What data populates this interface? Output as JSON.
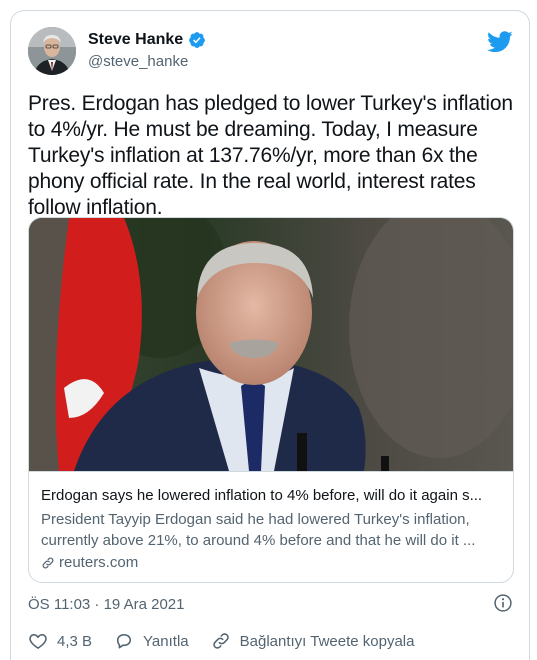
{
  "author": {
    "display_name": "Steve Hanke",
    "handle": "@steve_hanke",
    "verified": true,
    "avatar_icon": "avatar-portrait"
  },
  "tweet": {
    "text": "Pres. Erdogan has pledged to lower Turkey's inflation to 4%/yr. He must be dreaming. Today, I measure Turkey's inflation at 137.76%/yr, more than 6x the phony official rate. In the real world, interest rates follow inflation.",
    "timestamp": "ÖS 11:03 · 19 Ara 2021"
  },
  "link_card": {
    "title": "Erdogan says he lowered inflation to 4% before, will do it again s...",
    "description": "President Tayyip Erdogan said he had lowered Turkey's inflation, currently above 21%, to around 4% before and that he will do it ...",
    "domain": "reuters.com",
    "image_icon": "news-photo"
  },
  "actions": {
    "like_count": "4,3 B",
    "reply_label": "Yanıtla",
    "copy_link_label": "Bağlantıyı Tweete kopyala"
  },
  "colors": {
    "brand_blue": "#1d9bf0",
    "text_primary": "#0f1419",
    "text_secondary": "#536471",
    "border": "#cfd9de"
  }
}
